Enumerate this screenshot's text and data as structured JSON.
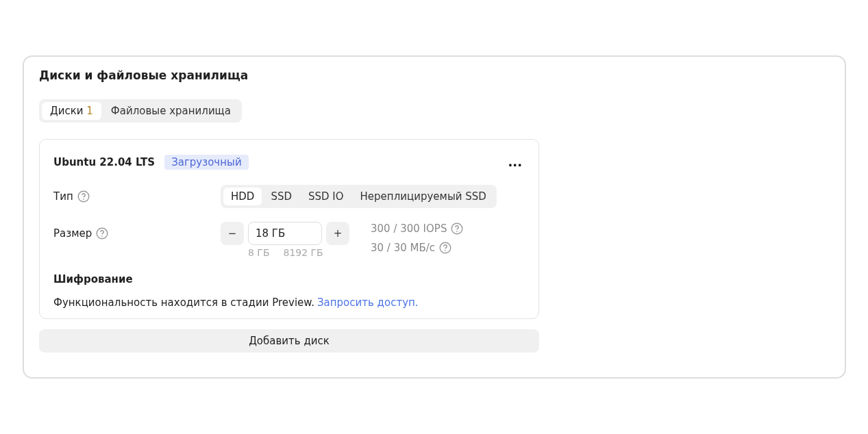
{
  "section": {
    "title": "Диски и файловые хранилища"
  },
  "tabs": [
    {
      "label": "Диски",
      "count": "1",
      "selected": true
    },
    {
      "label": "Файловые хранилища",
      "selected": false
    }
  ],
  "disk": {
    "name": "Ubuntu 22.04 LTS",
    "badge": "Загрузочный",
    "menu": "...",
    "type_label": "Тип",
    "types": [
      {
        "label": "HDD",
        "selected": true
      },
      {
        "label": "SSD",
        "selected": false
      },
      {
        "label": "SSD IO",
        "selected": false
      },
      {
        "label": "Нереплицируемый SSD",
        "selected": false
      }
    ],
    "size_label": "Размер",
    "minus": "−",
    "size_value": "18 ГБ",
    "plus": "+",
    "min": "8 ГБ",
    "max": "8192 ГБ",
    "iops": "300 / 300 IOPS",
    "bandwidth": "30 / 30 МБ/с",
    "encryption_title": "Шифрование",
    "encryption_text": "Функциональность находится в стадии Preview.",
    "encryption_link": "Запросить доступ."
  },
  "add_button": "Добавить диск"
}
